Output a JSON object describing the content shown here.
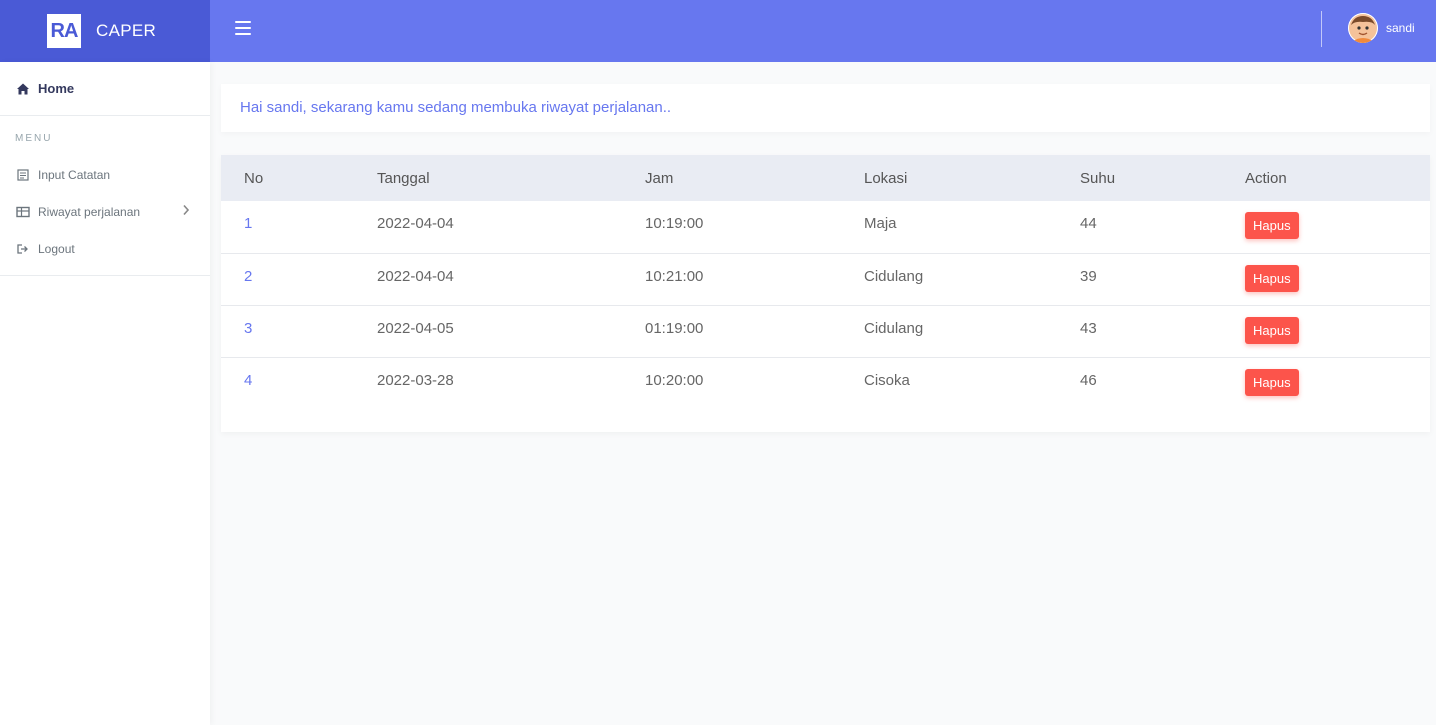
{
  "brand": {
    "logo_text": "RA",
    "name": "CAPER"
  },
  "topbar": {
    "user_name": "sandi"
  },
  "sidebar": {
    "home_label": "Home",
    "menu_header": "MENU",
    "items": [
      {
        "label": "Input Catatan",
        "icon": "note-icon"
      },
      {
        "label": "Riwayat perjalanan",
        "icon": "table-icon"
      },
      {
        "label": "Logout",
        "icon": "logout-icon"
      }
    ]
  },
  "welcome": {
    "text": "Hai sandi, sekarang kamu sedang membuka riwayat perjalanan.."
  },
  "table": {
    "headers": [
      "No",
      "Tanggal",
      "Jam",
      "Lokasi",
      "Suhu",
      "Action"
    ],
    "rows": [
      {
        "no": "1",
        "tanggal": "2022-04-04",
        "jam": "10:19:00",
        "lokasi": "Maja",
        "suhu": "44",
        "action": "Hapus"
      },
      {
        "no": "2",
        "tanggal": "2022-04-04",
        "jam": "10:21:00",
        "lokasi": "Cidulang",
        "suhu": "39",
        "action": "Hapus"
      },
      {
        "no": "3",
        "tanggal": "2022-04-05",
        "jam": "01:19:00",
        "lokasi": "Cidulang",
        "suhu": "43",
        "action": "Hapus"
      },
      {
        "no": "4",
        "tanggal": "2022-03-28",
        "jam": "10:20:00",
        "lokasi": "Cisoka",
        "suhu": "46",
        "action": "Hapus"
      }
    ]
  },
  "colors": {
    "primary": "#6777ef",
    "brand_bg": "#4a5ad6",
    "danger": "#fc544b"
  }
}
